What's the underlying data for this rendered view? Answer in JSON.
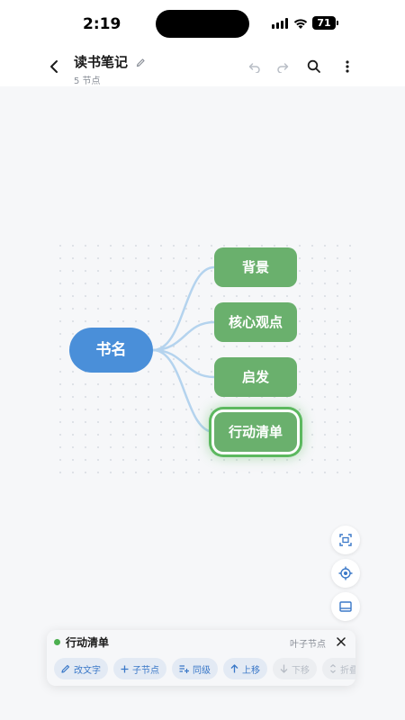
{
  "status_bar": {
    "time": "2:19",
    "battery": "71"
  },
  "header": {
    "title": "读书笔记",
    "subtitle": "5 节点",
    "icons": [
      "back-icon",
      "pencil-icon",
      "undo-icon",
      "redo-icon",
      "search-icon",
      "more-icon"
    ]
  },
  "mindmap": {
    "root": "书名",
    "children": [
      "背景",
      "核心观点",
      "启发",
      "行动清单"
    ],
    "selected": "行动清单",
    "colors": {
      "root": "#4a8fd9",
      "child": "#6ab06d",
      "link": "#b4d3ee",
      "selected_ring": "#5cb85f"
    }
  },
  "tools": [
    "fit-screen-icon",
    "locate-icon",
    "panel-icon"
  ],
  "panel": {
    "title": "行动清单",
    "tag": "叶子节点",
    "actions": [
      {
        "label": "改文字",
        "icon": "pencil-icon",
        "enabled": true
      },
      {
        "label": "子节点",
        "icon": "plus-icon",
        "enabled": true
      },
      {
        "label": "同级",
        "icon": "add-sibling-icon",
        "enabled": true
      },
      {
        "label": "上移",
        "icon": "arrow-up-icon",
        "enabled": true
      },
      {
        "label": "下移",
        "icon": "arrow-down-icon",
        "enabled": false
      },
      {
        "label": "折叠",
        "icon": "collapse-icon",
        "enabled": false
      }
    ]
  }
}
